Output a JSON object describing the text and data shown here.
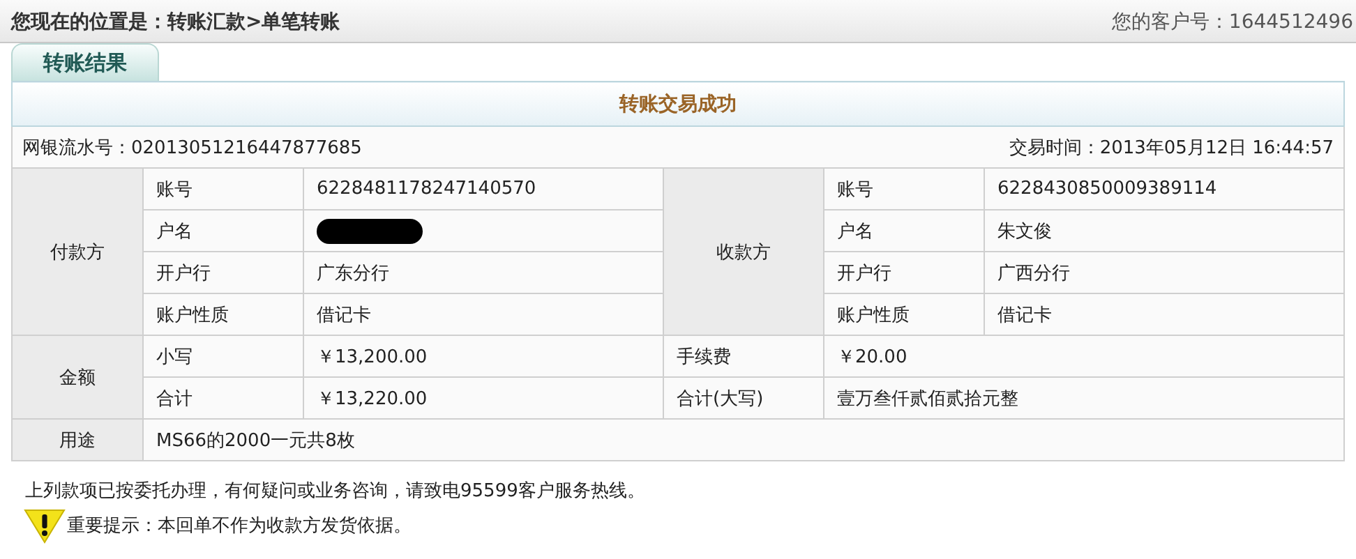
{
  "breadcrumb": "您现在的位置是：转账汇款>单笔转账",
  "customer_no": "您的客户号：1644512496",
  "tabs": [
    {
      "label": "转账结果",
      "selected": true
    }
  ],
  "result": {
    "title": "转账交易成功",
    "serial": "网银流水号：02013051216447877685",
    "time": "交易时间：2013年05月12日 16:44:57",
    "payer": {
      "label": "付款方",
      "fields": [
        {
          "label": "账号",
          "value": "6228481178247140570",
          "kind": "text"
        },
        {
          "label": "户名",
          "kind": "redacted"
        },
        {
          "label": "开户行",
          "value": "广东分行",
          "kind": "text"
        },
        {
          "label": "账户性质",
          "value": "借记卡",
          "kind": "text"
        }
      ]
    },
    "payee": {
      "label": "收款方",
      "fields": [
        {
          "label": "账号",
          "value": "6228430850009389114",
          "kind": "text"
        },
        {
          "label": "户名",
          "value": "朱文俊",
          "kind": "text"
        },
        {
          "label": "开户行",
          "value": "广西分行",
          "kind": "text"
        },
        {
          "label": "账户性质",
          "value": "借记卡",
          "kind": "text"
        }
      ]
    },
    "amount": {
      "label": "金额",
      "rows": [
        [
          "小写",
          "￥13,200.00",
          "手续费",
          "￥20.00"
        ],
        [
          "合计",
          "￥13,220.00",
          "合计(大写)",
          "壹万叁仟贰佰贰拾元整"
        ]
      ]
    },
    "purpose": {
      "label": "用途",
      "value": "MS66的2000一元共8枚"
    }
  },
  "notice": "上列款项已按委托办理，有何疑问或业务咨询，请致电95599客户服务热线。",
  "warning": "重要提示：本回单不作为收款方发货依据。"
}
